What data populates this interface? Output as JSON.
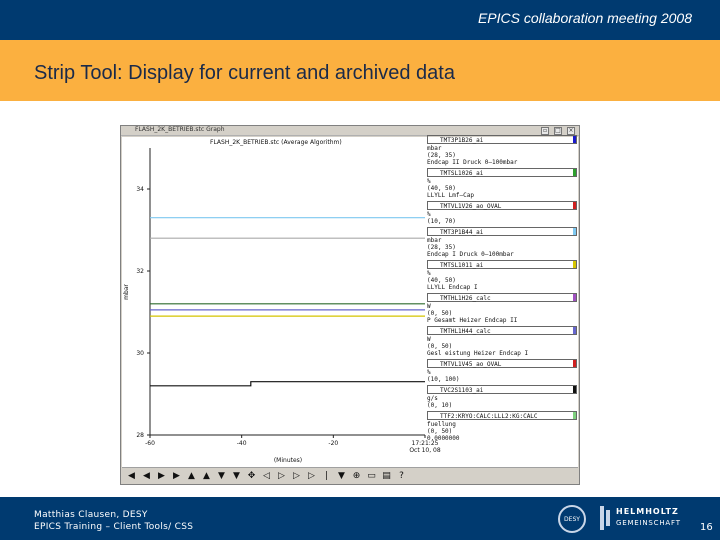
{
  "slide": {
    "event": "EPICS collaboration meeting 2008",
    "title": "Strip Tool: Display for current and archived data",
    "footer_author": "Matthias Clausen, DESY",
    "footer_course": "EPICS Training – Client Tools/ CSS",
    "desy_logo": "DESY",
    "helmholtz_line1": "HELMHOLTZ",
    "helmholtz_line2": "GEMEINSCHAFT",
    "page_number": "16"
  },
  "window": {
    "title": "FLASH_2K_BETRIEB.stc Graph",
    "btn_minimize": "▫",
    "btn_maximize": "□",
    "btn_close": "×"
  },
  "colors": {
    "topbar": "#003a70",
    "titleband": "#fbb040",
    "footer": "#003a70",
    "plot_bg": "#ffffff"
  },
  "chart_data": {
    "type": "line",
    "title": "FLASH_2K_BETRIEB.stc (Average Algorithm)",
    "ylabel": "mbar",
    "xlabel": "(Minutes)",
    "x_ticks": [
      "-60",
      "-40",
      "-20",
      "17:21:25\nOct 10, 08"
    ],
    "y_ticks": [
      "34",
      "32",
      "30",
      "28"
    ],
    "ylim": [
      28,
      35
    ],
    "xlim": [
      -60,
      0
    ],
    "grid": false,
    "legend_position": "right",
    "series": [
      {
        "points": [
          [
            -60,
            33.3
          ],
          [
            0,
            33.3
          ]
        ],
        "color": "#7ec8f0"
      },
      {
        "points": [
          [
            -60,
            32.8
          ],
          [
            0,
            32.8
          ]
        ],
        "color": "#aaaaaa"
      },
      {
        "points": [
          [
            -60,
            31.2
          ],
          [
            0,
            31.2
          ]
        ],
        "color": "#2e6b2e"
      },
      {
        "points": [
          [
            -60,
            31.05
          ],
          [
            0,
            31.05
          ]
        ],
        "color": "#6666cc"
      },
      {
        "points": [
          [
            -60,
            30.9
          ],
          [
            0,
            30.9
          ]
        ],
        "color": "#d4c400"
      },
      {
        "points": [
          [
            -60,
            29.2
          ],
          [
            -38,
            29.2
          ],
          [
            -38,
            29.3
          ],
          [
            0,
            29.3
          ]
        ],
        "color": "#111111"
      }
    ]
  },
  "legend": [
    {
      "name": "TMT3P1B26_ai",
      "color": "#1a1acc",
      "info": [
        "mbar",
        "(28, 35)",
        "Endcap II Druck 0–100mbar"
      ]
    },
    {
      "name": "TMTSL1026_ai",
      "color": "#2ea02e",
      "info": [
        "%",
        "(40, 50)",
        "LLYLL Lmf–Cap"
      ]
    },
    {
      "name": "TMTVL1V26_ao_OVAL",
      "color": "#d02020",
      "info": [
        "%",
        "(10, 70)"
      ]
    },
    {
      "name": "TMT3P1B44_ai",
      "color": "#7ec8f0",
      "info": [
        "mbar",
        "(28, 35)",
        "Endcap I Druck 0–100mbar"
      ]
    },
    {
      "name": "TMTSL1011_ai",
      "color": "#d4c400",
      "info": [
        "%",
        "(40, 50)",
        "LLYLL Endcap I"
      ]
    },
    {
      "name": "TMTHL1H26_calc",
      "color": "#a050c0",
      "info": [
        "W",
        "(0, 50)",
        "P Gesamt Heizer Endcap II"
      ]
    },
    {
      "name": "TMTHL1H44_calc",
      "color": "#6666cc",
      "info": [
        "W",
        "(0, 50)",
        "Gesl eistung Heizer Endcap I"
      ]
    },
    {
      "name": "TMTVL1V45_ao_OVAL",
      "color": "#d02020",
      "info": [
        "%",
        "(10, 100)"
      ]
    },
    {
      "name": "TVC2S1103_ai",
      "color": "#111111",
      "info": [
        "g/s",
        "(0, 10)"
      ]
    },
    {
      "name": "TTF2:KRYO:CALC:LLL2:KG:CALC",
      "color": "#7ed07e",
      "info": [
        "fuellung",
        "(0, 50)",
        "0.0000000"
      ]
    }
  ],
  "toolbar": {
    "buttons": [
      "◀",
      "◀",
      "▶",
      "▶",
      "▲",
      "▲",
      "▼",
      "▼",
      "✥",
      "◁",
      "▷",
      "▷",
      "▷",
      "|",
      "▼",
      "⊕",
      "▭",
      "▤",
      "?"
    ]
  }
}
